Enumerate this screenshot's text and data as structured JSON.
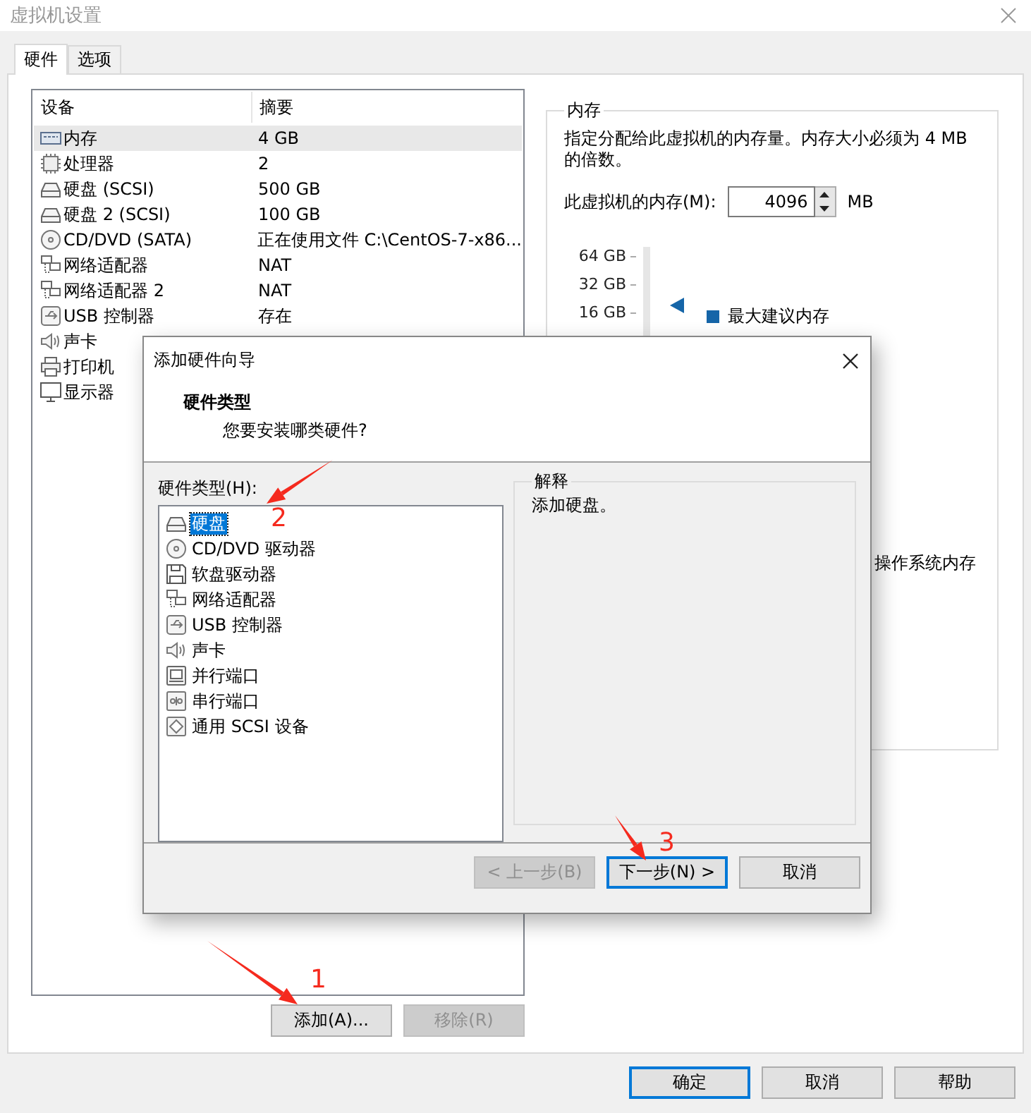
{
  "window": {
    "title": "虚拟机设置"
  },
  "tabs": [
    {
      "label": "硬件",
      "selected": true
    },
    {
      "label": "选项",
      "selected": false
    }
  ],
  "device_table": {
    "columns": [
      "设备",
      "摘要"
    ],
    "rows": [
      {
        "kind": "memory",
        "device": "内存",
        "summary": "4 GB",
        "selected": true
      },
      {
        "kind": "cpu",
        "device": "处理器",
        "summary": "2",
        "selected": false
      },
      {
        "kind": "disk",
        "device": "硬盘 (SCSI)",
        "summary": "500 GB",
        "selected": false
      },
      {
        "kind": "disk",
        "device": "硬盘 2 (SCSI)",
        "summary": "100 GB",
        "selected": false
      },
      {
        "kind": "cdrom",
        "device": "CD/DVD (SATA)",
        "summary": "正在使用文件 C:\\CentOS-7-x86...",
        "selected": false
      },
      {
        "kind": "network",
        "device": "网络适配器",
        "summary": "NAT",
        "selected": false
      },
      {
        "kind": "network",
        "device": "网络适配器 2",
        "summary": "NAT",
        "selected": false
      },
      {
        "kind": "usb",
        "device": "USB 控制器",
        "summary": "存在",
        "selected": false
      },
      {
        "kind": "sound",
        "device": "声卡",
        "selected": false
      },
      {
        "kind": "printer",
        "device": "打印机",
        "selected": false
      },
      {
        "kind": "display",
        "device": "显示器",
        "selected": false
      }
    ]
  },
  "device_buttons": [
    {
      "label": "添加(A)...",
      "disabled": false
    },
    {
      "label": "移除(R)",
      "disabled": true
    }
  ],
  "memory_panel": {
    "title": "内存",
    "description": "指定分配给此虚拟机的内存量。内存大小必须为 4 MB 的倍数。",
    "field_label": "此虚拟机的内存(M):",
    "value": "4096",
    "unit": "MB",
    "scale_labels": [
      "64 GB",
      "32 GB",
      "16 GB"
    ],
    "legend": [
      "最大建议内存"
    ],
    "legend_partial": "操作系统内存"
  },
  "dialog_buttons": [
    {
      "label": "确定",
      "default": true
    },
    {
      "label": "取消",
      "default": false
    },
    {
      "label": "帮助",
      "default": false
    }
  ],
  "wizard": {
    "title": "添加硬件向导",
    "heading": "硬件类型",
    "subheading": "您要安装哪类硬件?",
    "list_label": "硬件类型(H):",
    "items": [
      {
        "kind": "disk",
        "label": "硬盘",
        "selected": true
      },
      {
        "kind": "cdrom",
        "label": "CD/DVD 驱动器",
        "selected": false
      },
      {
        "kind": "floppy",
        "label": "软盘驱动器",
        "selected": false
      },
      {
        "kind": "network",
        "label": "网络适配器",
        "selected": false
      },
      {
        "kind": "usb",
        "label": "USB 控制器",
        "selected": false
      },
      {
        "kind": "sound",
        "label": "声卡",
        "selected": false
      },
      {
        "kind": "parallel",
        "label": "并行端口",
        "selected": false
      },
      {
        "kind": "serial",
        "label": "串行端口",
        "selected": false
      },
      {
        "kind": "scsi",
        "label": "通用 SCSI 设备",
        "selected": false
      }
    ],
    "explanation_title": "解释",
    "explanation": "添加硬盘。",
    "buttons": [
      {
        "label": "< 上一步(B)",
        "disabled": true,
        "default": false
      },
      {
        "label": "下一步(N) >",
        "disabled": false,
        "default": true
      },
      {
        "label": "取消",
        "disabled": false,
        "default": false
      }
    ]
  },
  "annotations": [
    {
      "label": "1"
    },
    {
      "label": "2"
    },
    {
      "label": "3"
    }
  ]
}
